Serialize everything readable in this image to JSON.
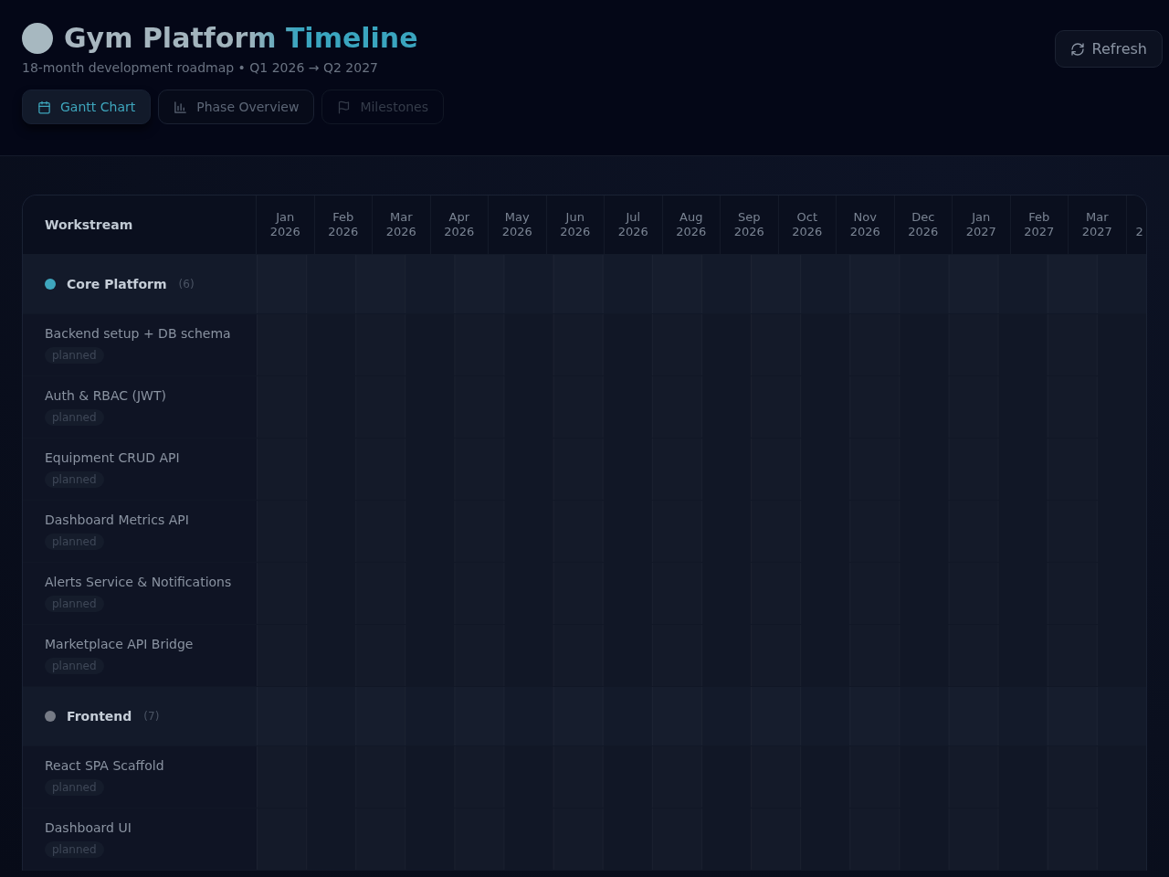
{
  "header": {
    "title": "Gym Platform Timeline",
    "subtitle": "18-month development roadmap • Q1 2026 → Q2 2027"
  },
  "tabs": [
    {
      "label": "Gantt Chart",
      "selected": true,
      "disabled": false
    },
    {
      "label": "Phase Overview",
      "selected": false,
      "disabled": false
    },
    {
      "label": "Milestones",
      "selected": false,
      "disabled": true
    }
  ],
  "refresh_button": {
    "label": "Refresh"
  },
  "gantt": {
    "workstream_heading": "Workstream",
    "months": [
      {
        "month": "Jan",
        "year": "2026"
      },
      {
        "month": "Feb",
        "year": "2026"
      },
      {
        "month": "Mar",
        "year": "2026"
      },
      {
        "month": "Apr",
        "year": "2026"
      },
      {
        "month": "May",
        "year": "2026"
      },
      {
        "month": "Jun",
        "year": "2026"
      },
      {
        "month": "Jul",
        "year": "2026"
      },
      {
        "month": "Aug",
        "year": "2026"
      },
      {
        "month": "Sep",
        "year": "2026"
      },
      {
        "month": "Oct",
        "year": "2026"
      },
      {
        "month": "Nov",
        "year": "2026"
      },
      {
        "month": "Dec",
        "year": "2026"
      },
      {
        "month": "Jan",
        "year": "2027"
      },
      {
        "month": "Feb",
        "year": "2027"
      },
      {
        "month": "Mar",
        "year": "2027"
      },
      {
        "year": "2"
      }
    ],
    "groups": [
      {
        "name": "Core Platform",
        "count": "(6)",
        "color": "#3ea6bd",
        "tasks": [
          {
            "name": "Backend setup + DB schema",
            "status": "planned"
          },
          {
            "name": "Auth & RBAC (JWT)",
            "status": "planned"
          },
          {
            "name": "Equipment CRUD API",
            "status": "planned"
          },
          {
            "name": "Dashboard Metrics API",
            "status": "planned"
          },
          {
            "name": "Alerts Service & Notifications",
            "status": "planned"
          },
          {
            "name": "Marketplace API Bridge",
            "status": "planned"
          }
        ]
      },
      {
        "name": "Frontend",
        "count": "(7)",
        "color": "#767b86",
        "tasks": [
          {
            "name": "React SPA Scaffold",
            "status": "planned"
          },
          {
            "name": "Dashboard UI",
            "status": "planned"
          }
        ]
      }
    ]
  }
}
